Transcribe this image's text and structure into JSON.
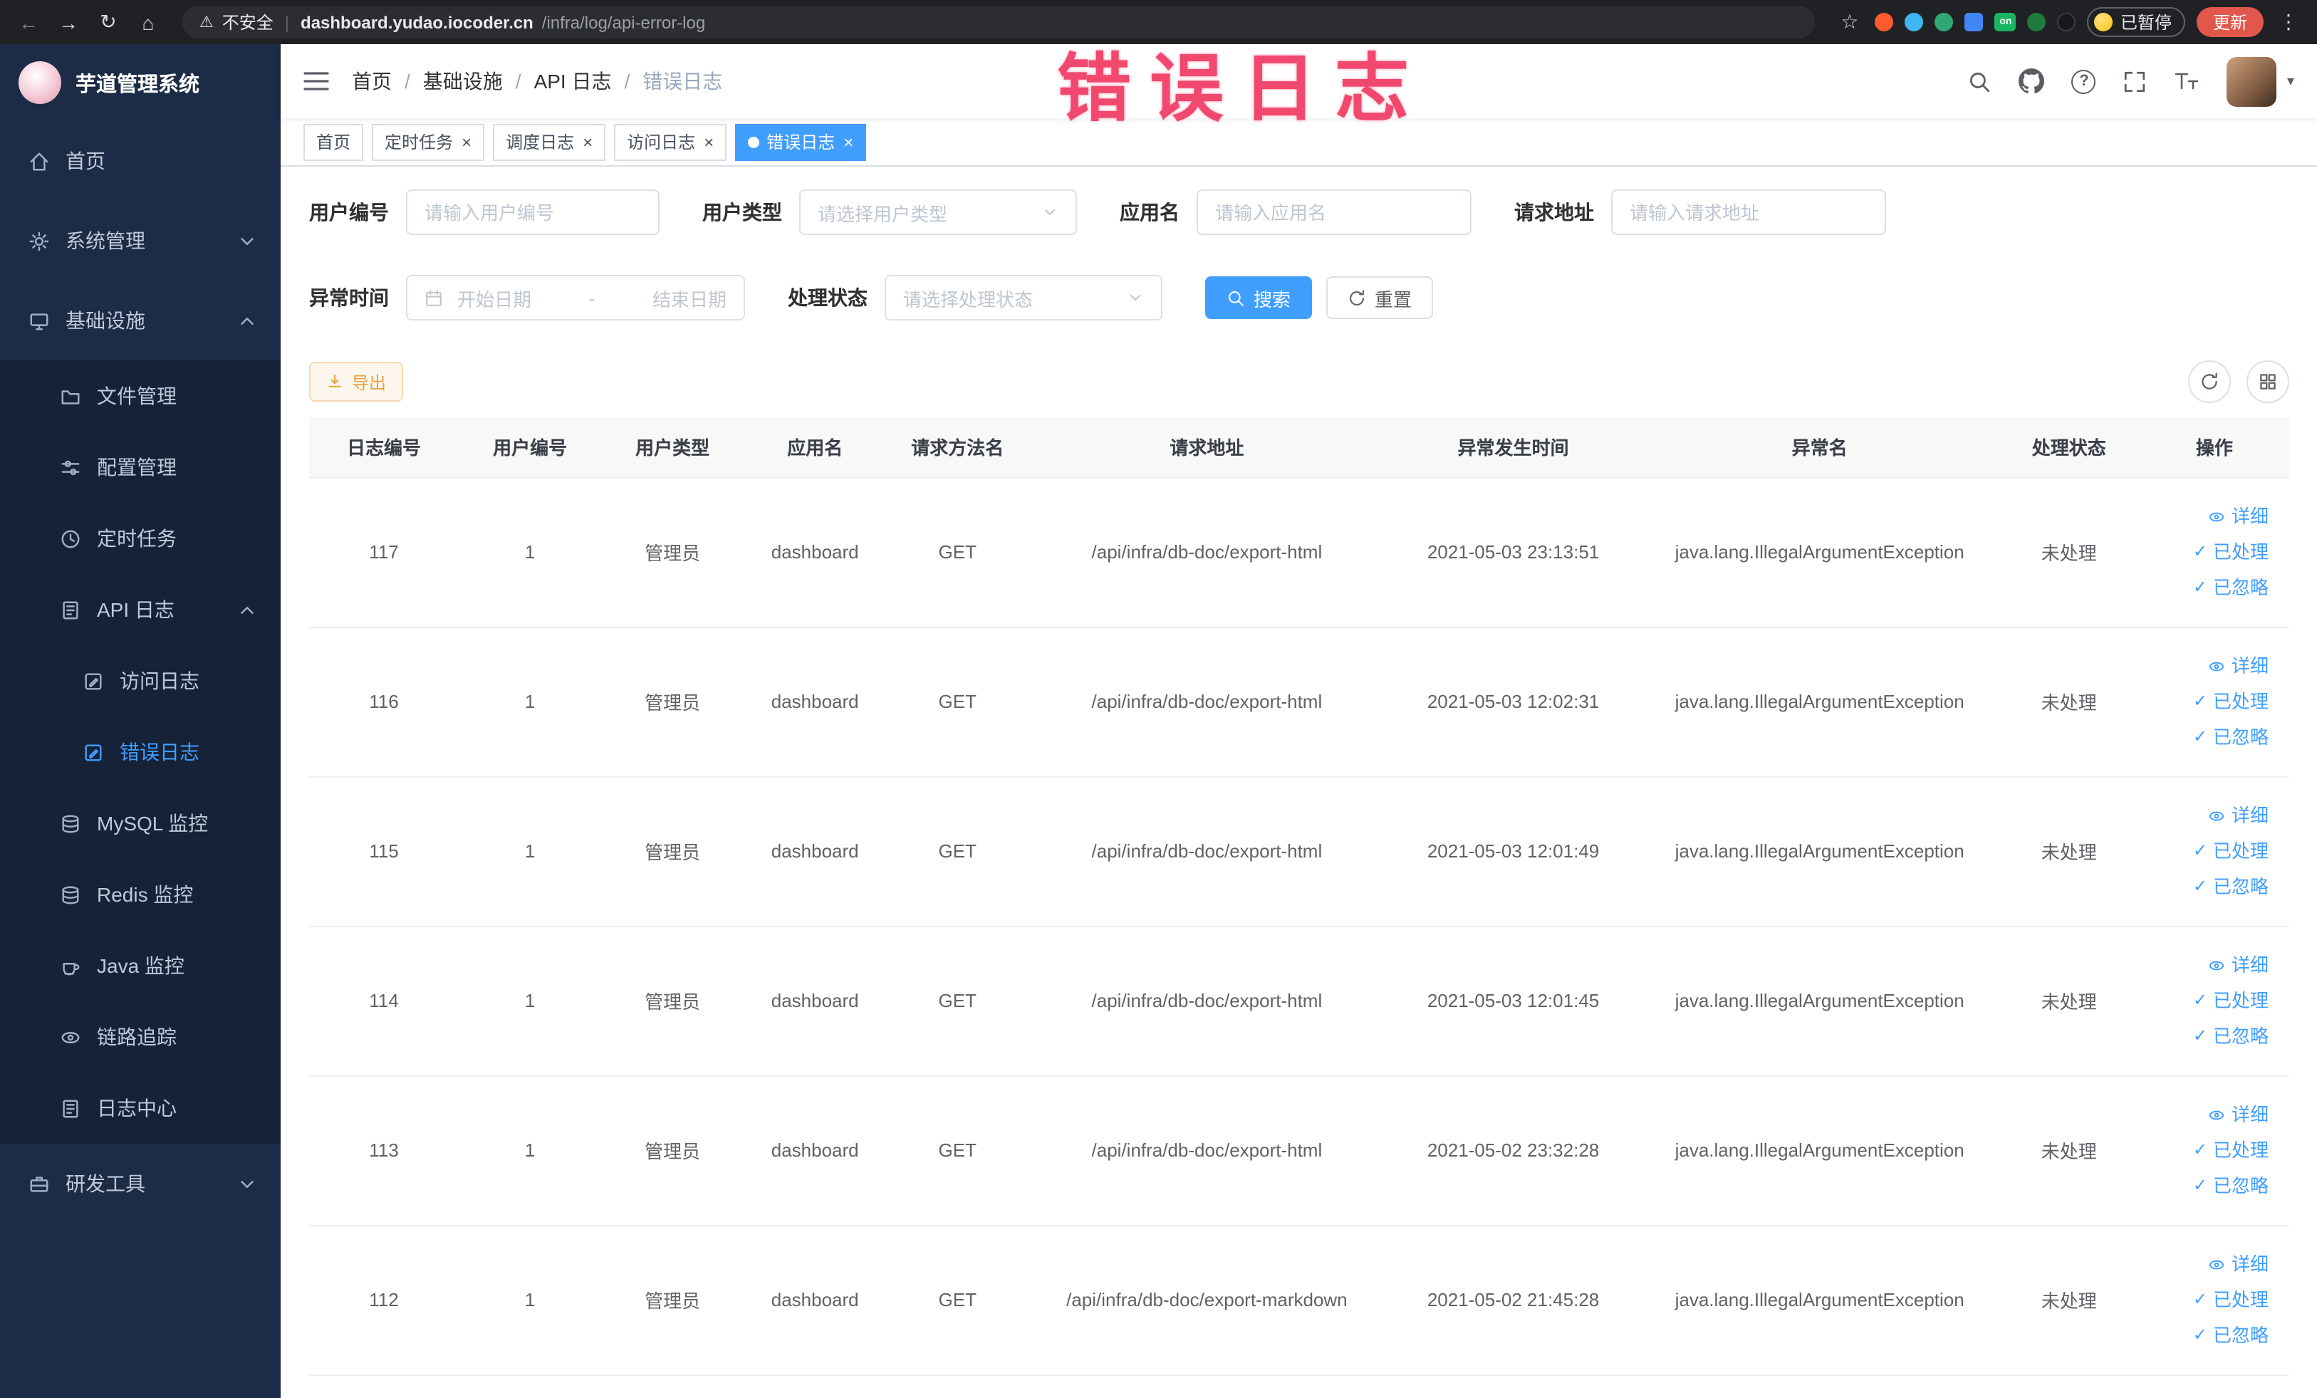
{
  "colors": {
    "primary": "#409eff",
    "annotation": "#f1486e",
    "sidebar_bg": "#1c2b46"
  },
  "browser": {
    "security_label": "不安全",
    "url_domain": "dashboard.yudao.iocoder.cn",
    "url_path": "/infra/log/api-error-log",
    "ext_on": "on",
    "paused_badge": "已暂停",
    "update_button": "更新"
  },
  "annotation": {
    "text": "错误日志"
  },
  "sidebar": {
    "title": "芋道管理系统",
    "items": [
      {
        "label": "首页"
      },
      {
        "label": "系统管理"
      },
      {
        "label": "基础设施"
      },
      {
        "label": "文件管理"
      },
      {
        "label": "配置管理"
      },
      {
        "label": "定时任务"
      },
      {
        "label": "API 日志"
      },
      {
        "label": "访问日志"
      },
      {
        "label": "错误日志"
      },
      {
        "label": "MySQL 监控"
      },
      {
        "label": "Redis 监控"
      },
      {
        "label": "Java 监控"
      },
      {
        "label": "链路追踪"
      },
      {
        "label": "日志中心"
      },
      {
        "label": "研发工具"
      }
    ]
  },
  "header": {
    "breadcrumb": [
      "首页",
      "基础设施",
      "API 日志",
      "错误日志"
    ]
  },
  "tags": [
    {
      "label": "首页"
    },
    {
      "label": "定时任务"
    },
    {
      "label": "调度日志"
    },
    {
      "label": "访问日志"
    },
    {
      "label": "错误日志"
    }
  ],
  "filters": {
    "user_id": {
      "label": "用户编号",
      "placeholder": "请输入用户编号"
    },
    "user_type": {
      "label": "用户类型",
      "placeholder": "请选择用户类型"
    },
    "app_name": {
      "label": "应用名",
      "placeholder": "请输入应用名"
    },
    "request_url": {
      "label": "请求地址",
      "placeholder": "请输入请求地址"
    },
    "exception_time": {
      "label": "异常时间",
      "start_placeholder": "开始日期",
      "separator": "-",
      "end_placeholder": "结束日期"
    },
    "process_status": {
      "label": "处理状态",
      "placeholder": "请选择处理状态"
    },
    "search_button": "搜索",
    "reset_button": "重置"
  },
  "toolbar": {
    "export_label": "导出"
  },
  "table": {
    "columns": [
      "日志编号",
      "用户编号",
      "用户类型",
      "应用名",
      "请求方法名",
      "请求地址",
      "异常发生时间",
      "异常名",
      "处理状态",
      "操作"
    ],
    "actions": {
      "detail": "详细",
      "done": "已处理",
      "ignore": "已忽略"
    },
    "rows": [
      {
        "log_id": "117",
        "user_id": "1",
        "user_type": "管理员",
        "app_name": "dashboard",
        "method": "GET",
        "url": "/api/infra/db-doc/export-html",
        "time": "2021-05-03 23:13:51",
        "exception": "java.lang.IllegalArgumentException",
        "status": "未处理"
      },
      {
        "log_id": "116",
        "user_id": "1",
        "user_type": "管理员",
        "app_name": "dashboard",
        "method": "GET",
        "url": "/api/infra/db-doc/export-html",
        "time": "2021-05-03 12:02:31",
        "exception": "java.lang.IllegalArgumentException",
        "status": "未处理"
      },
      {
        "log_id": "115",
        "user_id": "1",
        "user_type": "管理员",
        "app_name": "dashboard",
        "method": "GET",
        "url": "/api/infra/db-doc/export-html",
        "time": "2021-05-03 12:01:49",
        "exception": "java.lang.IllegalArgumentException",
        "status": "未处理"
      },
      {
        "log_id": "114",
        "user_id": "1",
        "user_type": "管理员",
        "app_name": "dashboard",
        "method": "GET",
        "url": "/api/infra/db-doc/export-html",
        "time": "2021-05-03 12:01:45",
        "exception": "java.lang.IllegalArgumentException",
        "status": "未处理"
      },
      {
        "log_id": "113",
        "user_id": "1",
        "user_type": "管理员",
        "app_name": "dashboard",
        "method": "GET",
        "url": "/api/infra/db-doc/export-html",
        "time": "2021-05-02 23:32:28",
        "exception": "java.lang.IllegalArgumentException",
        "status": "未处理"
      },
      {
        "log_id": "112",
        "user_id": "1",
        "user_type": "管理员",
        "app_name": "dashboard",
        "method": "GET",
        "url": "/api/infra/db-doc/export-markdown",
        "time": "2021-05-02 21:45:28",
        "exception": "java.lang.IllegalArgumentException",
        "status": "未处理"
      }
    ]
  }
}
